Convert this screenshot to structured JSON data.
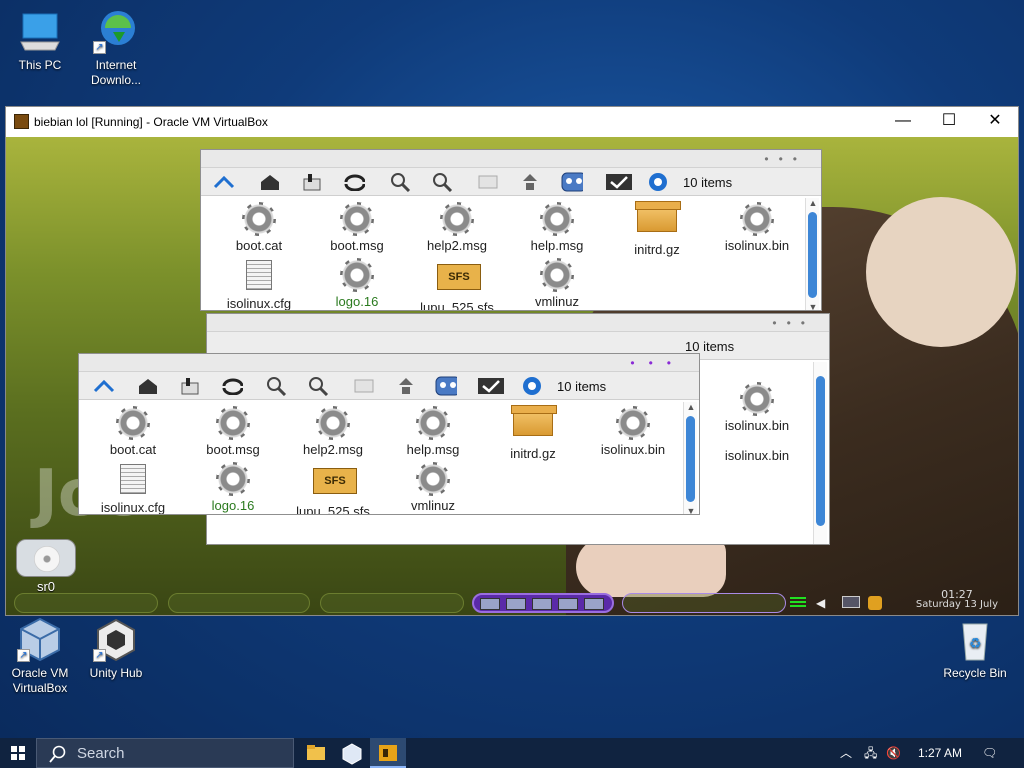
{
  "desktop": {
    "icons": [
      {
        "label": "This PC",
        "icon": "monitor-icon"
      },
      {
        "label": "Internet Downlo...",
        "icon": "internet-download-manager-icon"
      },
      {
        "label": "Oracle VM VirtualBox",
        "icon": "virtualbox-icon"
      },
      {
        "label": "Unity Hub",
        "icon": "unity-hub-icon"
      },
      {
        "label": "Recycle Bin",
        "icon": "recycle-bin-icon"
      }
    ]
  },
  "vbox": {
    "title": "biebian lol [Running] - Oracle VM VirtualBox",
    "controls": {
      "minimize": "—",
      "maximize": "☐",
      "close": "✕"
    }
  },
  "guest": {
    "toolbar_count": "10 items",
    "files": [
      {
        "name": "boot.cat",
        "icon": "gear-icon"
      },
      {
        "name": "boot.msg",
        "icon": "gear-icon"
      },
      {
        "name": "help2.msg",
        "icon": "gear-icon"
      },
      {
        "name": "help.msg",
        "icon": "gear-icon"
      },
      {
        "name": "initrd.gz",
        "icon": "archive-box-icon"
      },
      {
        "name": "isolinux.bin",
        "icon": "gear-icon"
      },
      {
        "name": "isolinux.cfg",
        "icon": "text-file-icon"
      },
      {
        "name": "logo.16",
        "icon": "gear-icon"
      },
      {
        "name": "lupu_525.sfs",
        "icon": "sfs-package-icon"
      },
      {
        "name": "vmlinuz",
        "icon": "gear-icon"
      }
    ],
    "desktop_drive": {
      "label": "sr0",
      "icon": "cd-drive-icon"
    },
    "clock": {
      "time": "01:27",
      "date": "Saturday 13 July"
    }
  },
  "taskbar": {
    "search_placeholder": "Search",
    "time": "1:27 AM"
  },
  "colors": {
    "accent": "#2d4a72",
    "guest_bg": "#7c912b",
    "file_label_green": "#2a7a1e"
  }
}
